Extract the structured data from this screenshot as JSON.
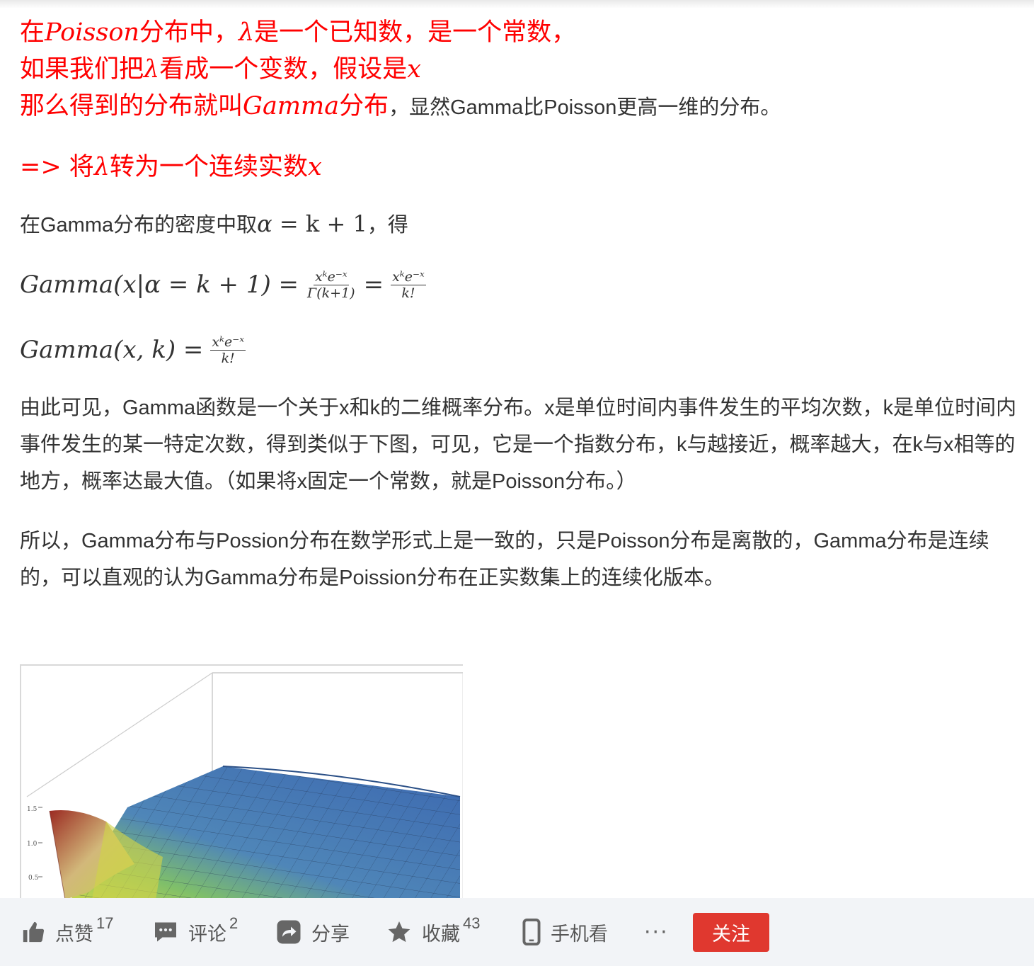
{
  "red_block": {
    "line1_a": "在",
    "line1_b": "Poisson",
    "line1_c": "分布中，",
    "line1_d": "λ",
    "line1_e": "是一个已知数，是一个常数，",
    "line2_a": "如果我们把",
    "line2_b": "λ",
    "line2_c": "看成一个变数，假设是",
    "line2_d": "x",
    "line3_a": "那么得到的分布就叫",
    "line3_b": "Gamma",
    "line3_c": "分布",
    "line3_plain": "，显然Gamma比Poisson更高一维的分布。"
  },
  "arrow_line": {
    "a": "=> 将",
    "b": "λ",
    "c": "转为一个连续实数",
    "d": "x"
  },
  "para_alpha": {
    "text": "在Gamma分布的密度中取",
    "math_alpha": "α",
    "math_rest": " = k + 1",
    "tail": "，得"
  },
  "eq1": {
    "lhs": "Gamma(x|α = k + 1) =",
    "frac1_num": "xᵏe⁻ˣ",
    "frac1_den": "Γ(k+1)",
    "eq_sign": "=",
    "frac2_num": "xᵏe⁻ˣ",
    "frac2_den": "k!"
  },
  "eq2": {
    "lhs": "Gamma(x, k) =",
    "frac_num": "xᵏe⁻ˣ",
    "frac_den": "k!"
  },
  "para1": "由此可见，Gamma函数是一个关于x和k的二维概率分布。x是单位时间内事件发生的平均次数，k是单位时间内事件发生的某一特定次数，得到类似于下图，可见，它是一个指数分布，k与越接近，概率越大，在k与x相等的地方，概率达最大值。（如果将x固定一个常数，就是Poisson分布。）",
  "para2": "所以，Gamma分布与Possion分布在数学形式上是一致的，只是Poisson分布是离散的，Gamma分布是连续的，可以直观的认为Gamma分布是Poission分布在正实数集上的连续化版本。",
  "figure": {
    "tick_15": "1.5",
    "tick_10": "1.0",
    "tick_05": "0.5"
  },
  "bottom_bar": {
    "like_label": "点赞",
    "like_count": "17",
    "comment_label": "评论",
    "comment_count": "2",
    "share_label": "分享",
    "collect_label": "收藏",
    "collect_count": "43",
    "mobile_label": "手机看",
    "more_label": "···",
    "follow_label": "关注"
  },
  "colors": {
    "red_text": "#ff0000",
    "follow_bg": "#e0382f",
    "bar_bg": "#f2f4f7"
  }
}
